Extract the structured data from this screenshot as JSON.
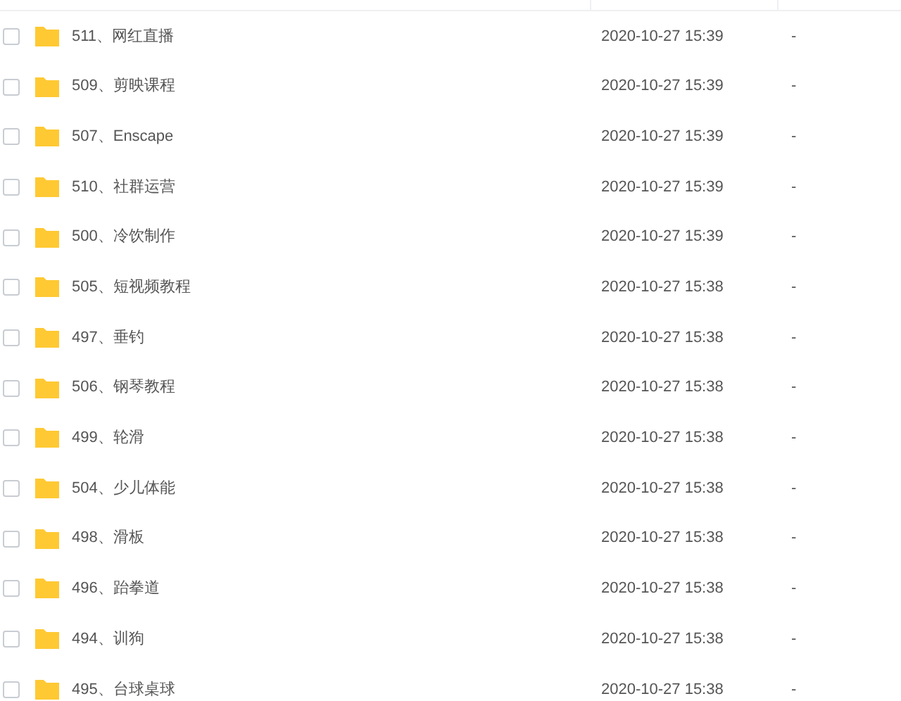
{
  "files": [
    {
      "name": "511、网红直播",
      "modified": "2020-10-27 15:39",
      "size": "-",
      "checked": false
    },
    {
      "name": "509、剪映课程",
      "modified": "2020-10-27 15:39",
      "size": "-",
      "checked": false
    },
    {
      "name": "507、Enscape",
      "modified": "2020-10-27 15:39",
      "size": "-",
      "checked": false
    },
    {
      "name": "510、社群运营",
      "modified": "2020-10-27 15:39",
      "size": "-",
      "checked": false
    },
    {
      "name": "500、冷饮制作",
      "modified": "2020-10-27 15:39",
      "size": "-",
      "checked": false
    },
    {
      "name": "505、短视频教程",
      "modified": "2020-10-27 15:38",
      "size": "-",
      "checked": false
    },
    {
      "name": "497、垂钓",
      "modified": "2020-10-27 15:38",
      "size": "-",
      "checked": false
    },
    {
      "name": "506、钢琴教程",
      "modified": "2020-10-27 15:38",
      "size": "-",
      "checked": false
    },
    {
      "name": "499、轮滑",
      "modified": "2020-10-27 15:38",
      "size": "-",
      "checked": false
    },
    {
      "name": "504、少儿体能",
      "modified": "2020-10-27 15:38",
      "size": "-",
      "checked": false
    },
    {
      "name": "498、滑板",
      "modified": "2020-10-27 15:38",
      "size": "-",
      "checked": false
    },
    {
      "name": "496、跆拳道",
      "modified": "2020-10-27 15:38",
      "size": "-",
      "checked": false
    },
    {
      "name": "494、训狗",
      "modified": "2020-10-27 15:38",
      "size": "-",
      "checked": false
    },
    {
      "name": "495、台球桌球",
      "modified": "2020-10-27 15:38",
      "size": "-",
      "checked": false
    }
  ]
}
